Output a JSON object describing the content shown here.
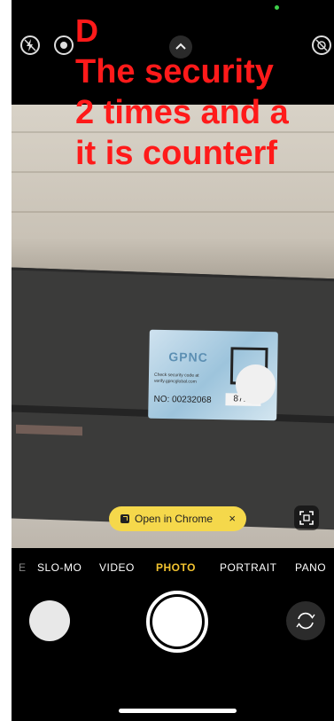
{
  "overlay": {
    "line1": "D",
    "line2": "The security",
    "line3": "2 times and a",
    "line4": "it is counterf"
  },
  "label": {
    "brand": "GPNC",
    "check_text": "Check security code at verify.gpncglobal.com",
    "number": "NO: 00232068",
    "code": "8714"
  },
  "suggestion": {
    "label": "Open in Chrome",
    "close": "×"
  },
  "modes": {
    "prefix": "E",
    "slomo": "SLO-MO",
    "video": "VIDEO",
    "photo": "PHOTO",
    "portrait": "PORTRAIT",
    "pano": "PANO"
  },
  "icons": {
    "flash": "flash-off-icon",
    "live": "live-photo-icon",
    "chevron": "chevron-up-icon",
    "noflash": "live-off-icon",
    "qr": "qr-scan-icon",
    "switch": "camera-switch-icon"
  },
  "colors": {
    "active_mode": "#f3c430",
    "overlay_text": "#ff1a1a",
    "pill": "#f5d84b"
  }
}
